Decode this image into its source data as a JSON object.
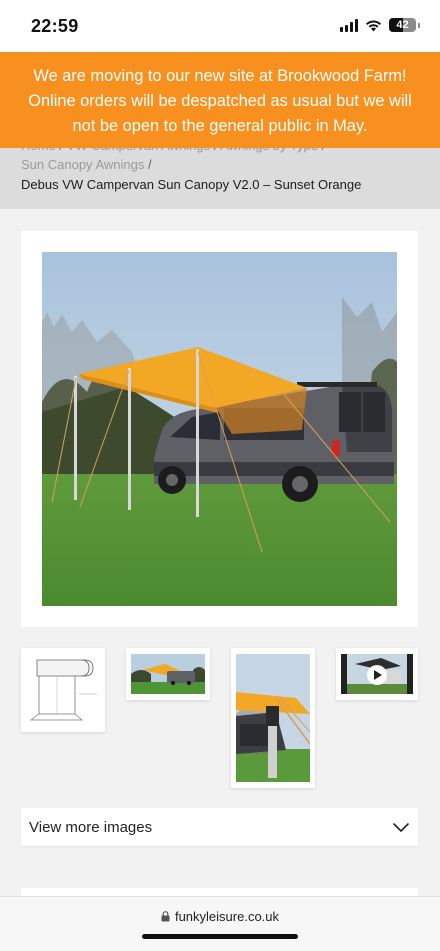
{
  "status_bar": {
    "time": "22:59",
    "battery_level": "42"
  },
  "announcement": {
    "lines": [
      "We are moving to our new site at Brookwood Farm!",
      "Online orders will be despatched as usual but we will",
      "not be open to the general public in May."
    ],
    "background_color": "#f7901e"
  },
  "breadcrumb": {
    "items": [
      {
        "label": "Home",
        "separator": " / "
      },
      {
        "label": "VW Campervan Awnings",
        "separator": " / "
      },
      {
        "label": "Awnings by Type",
        "separator": " /"
      },
      {
        "label": "Sun Canopy Awnings",
        "separator": " /"
      }
    ],
    "current": "Debus VW Campervan Sun Canopy V2.0 – Sunset Orange"
  },
  "gallery": {
    "main_image": "campervan-sun-canopy-photo",
    "thumbnails": [
      {
        "name": "canopy-diagram-thumbnail"
      },
      {
        "name": "canopy-wide-thumbnail"
      },
      {
        "name": "canopy-pole-closeup-thumbnail"
      },
      {
        "name": "canopy-video-thumbnail",
        "has_play_icon": true
      }
    ],
    "view_more_label": "View more images"
  },
  "browser": {
    "url": "funkyleisure.co.uk"
  }
}
